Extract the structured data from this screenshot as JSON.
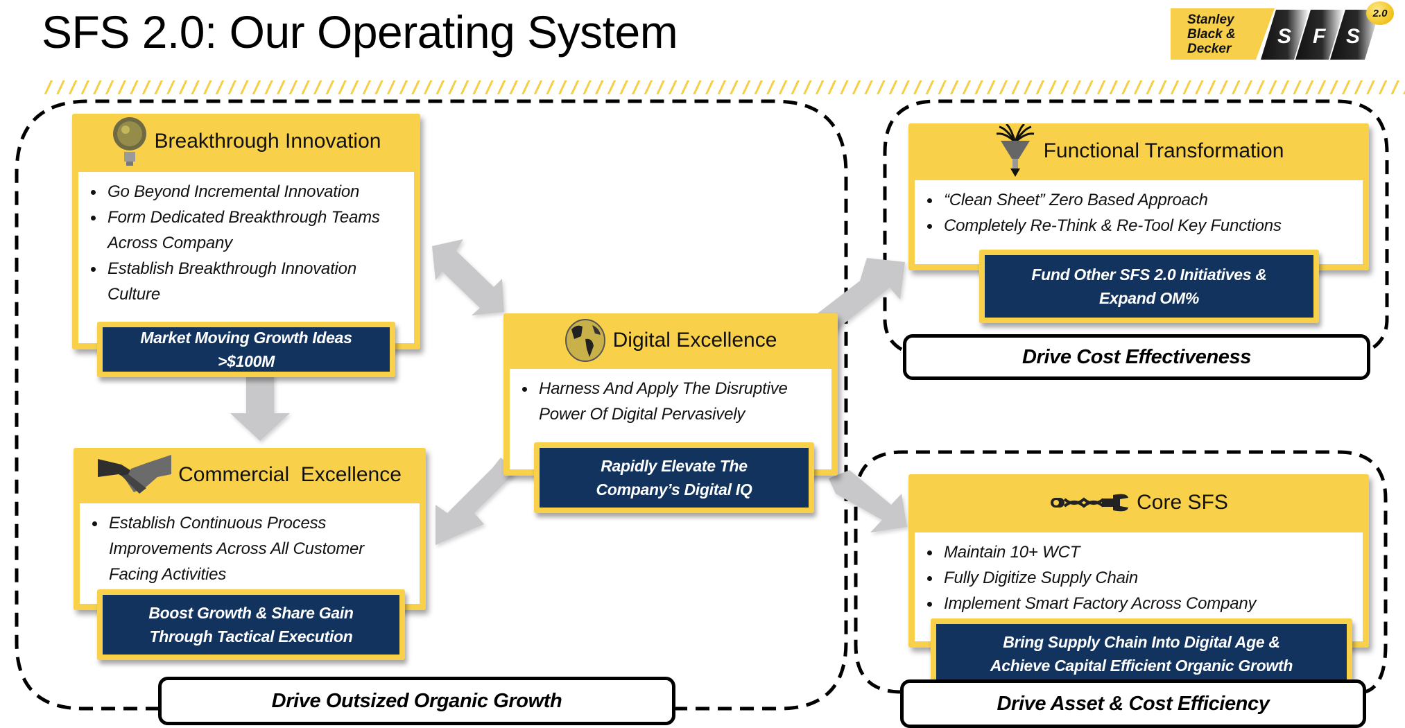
{
  "title": "SFS 2.0: Our Operating System",
  "logo": {
    "brand_lines": [
      "Stanley",
      "Black &",
      "Decker"
    ],
    "letters": [
      "S",
      "F",
      "S"
    ],
    "badge": "2.0"
  },
  "colors": {
    "card_yellow": "#f8d04a",
    "outcome_navy": "#13335f",
    "arrow_gray": "#c8c8ca",
    "stripe_yellow": "#f6cf47"
  },
  "cards": {
    "breakthrough": {
      "icon": "lightbulb-icon",
      "title": "Breakthrough Innovation",
      "bullets": [
        "Go Beyond Incremental Innovation",
        "Form Dedicated Breakthrough Teams Across Company",
        "Establish Breakthrough Innovation Culture"
      ],
      "outcome_lines": [
        "Market Moving Growth Ideas",
        ">$100M"
      ]
    },
    "commercial": {
      "icon": "handshake-icon",
      "title": "Commercial  Excellence",
      "bullets": [
        "Establish Continuous Process Improvements Across All Customer Facing Activities"
      ],
      "outcome_lines": [
        "Boost Growth & Share Gain",
        "Through Tactical Execution"
      ]
    },
    "digital": {
      "icon": "globe-icon",
      "title": "Digital Excellence",
      "bullets": [
        "Harness And Apply The Disruptive Power Of Digital Pervasively"
      ],
      "outcome_lines": [
        "Rapidly Elevate The",
        "Company’s Digital IQ"
      ]
    },
    "functional": {
      "icon": "funnel-icon",
      "title": "Functional Transformation",
      "bullets": [
        "“Clean Sheet” Zero Based Approach",
        "Completely Re-Think & Re-Tool Key Functions"
      ],
      "outcome_lines": [
        "Fund Other SFS 2.0 Initiatives &",
        "Expand OM%"
      ]
    },
    "core": {
      "icon": "dna-wrench-icon",
      "title": "Core SFS",
      "bullets": [
        "Maintain 10+ WCT",
        "Fully Digitize Supply Chain",
        "Implement Smart Factory Across Company"
      ],
      "outcome_lines": [
        "Bring Supply Chain Into Digital Age &",
        "Achieve Capital Efficient Organic Growth"
      ]
    }
  },
  "goals": {
    "growth": "Drive Outsized Organic Growth",
    "cost": "Drive Cost Effectiveness",
    "asset": "Drive Asset & Cost Efficiency"
  }
}
